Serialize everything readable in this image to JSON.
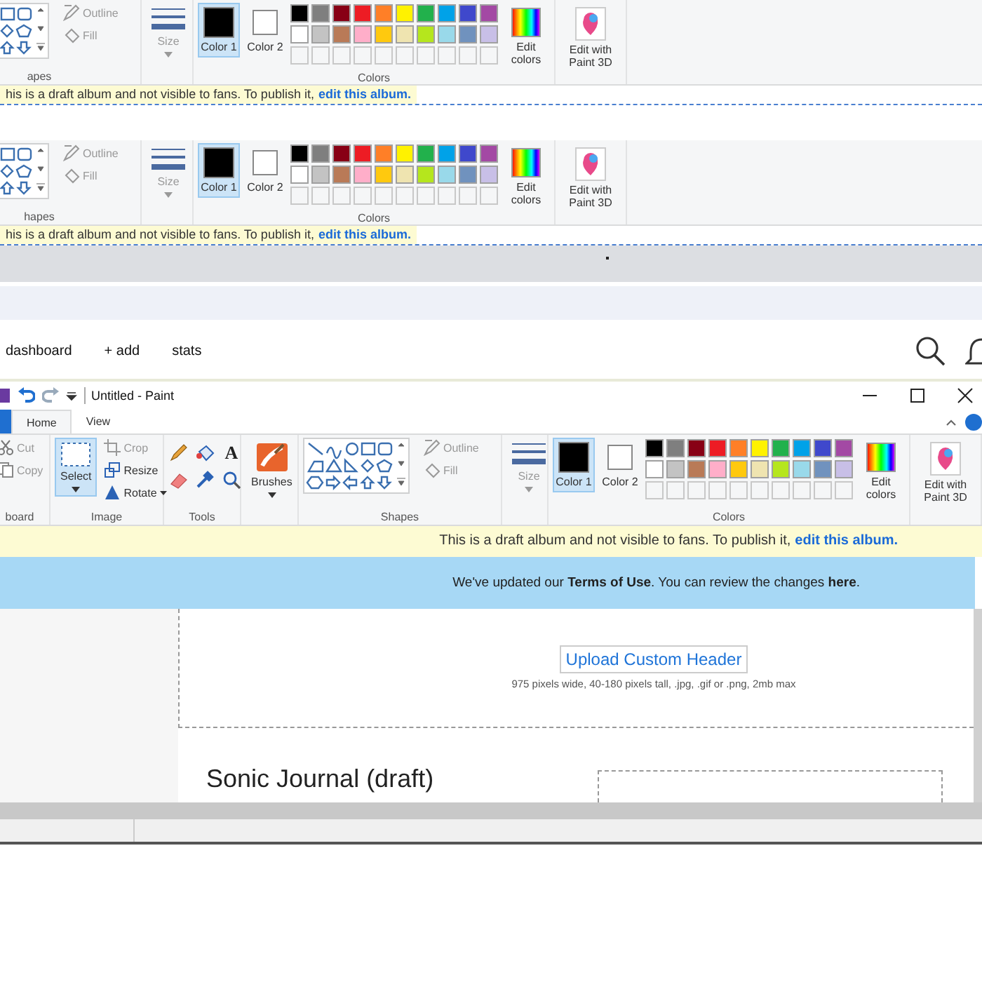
{
  "top_ribbons": [
    {
      "shapes_label": "apes",
      "outline": "Outline",
      "fill": "Fill",
      "size": "Size",
      "colors": [
        {
          "label": "Color 1",
          "selected": true
        },
        {
          "label": "Color 2",
          "selected": false
        }
      ],
      "palette": [
        {
          "color": "#000000"
        },
        {
          "color": "#7f7f7f"
        },
        {
          "color": "#880015"
        },
        {
          "color": "#ed1c24"
        },
        {
          "color": "#ff7f27"
        },
        {
          "color": "#fff200"
        },
        {
          "color": "#22b14c"
        },
        {
          "color": "#00a2e8"
        },
        {
          "color": "#3f48cc"
        },
        {
          "color": "#a349a4"
        },
        {
          "color": "#ffffff"
        },
        {
          "color": "#c3c3c3"
        },
        {
          "color": "#b97a57"
        },
        {
          "color": "#ffaec9"
        },
        {
          "color": "#ffc90e"
        },
        {
          "color": "#efe4b0"
        },
        {
          "color": "#b5e61d"
        },
        {
          "color": "#99d9ea"
        },
        {
          "color": "#7092be"
        },
        {
          "color": "#c8bfe7"
        }
      ],
      "edit_colors": "Edit colors",
      "paint_3d": "Edit with Paint 3D",
      "colors_label": "Colors",
      "draft_notice": "his is a draft album and not visible to fans. To publish it,",
      "draft_link": "edit this album."
    },
    {
      "shapes_label": "hapes",
      "outline": "Outline",
      "fill": "Fill",
      "size": "Size",
      "colors": [
        {
          "label": "Color 1",
          "selected": true
        },
        {
          "label": "Color 2",
          "selected": false
        }
      ],
      "palette": [
        {
          "color": "#000000"
        },
        {
          "color": "#7f7f7f"
        },
        {
          "color": "#880015"
        },
        {
          "color": "#ed1c24"
        },
        {
          "color": "#ff7f27"
        },
        {
          "color": "#fff200"
        },
        {
          "color": "#22b14c"
        },
        {
          "color": "#00a2e8"
        },
        {
          "color": "#3f48cc"
        },
        {
          "color": "#a349a4"
        },
        {
          "color": "#ffffff"
        },
        {
          "color": "#c3c3c3"
        },
        {
          "color": "#b97a57"
        },
        {
          "color": "#ffaec9"
        },
        {
          "color": "#ffc90e"
        },
        {
          "color": "#efe4b0"
        },
        {
          "color": "#b5e61d"
        },
        {
          "color": "#99d9ea"
        },
        {
          "color": "#7092be"
        },
        {
          "color": "#c8bfe7"
        }
      ],
      "edit_colors": "Edit colors",
      "paint_3d": "Edit with Paint 3D",
      "colors_label": "Colors",
      "draft_notice": "his is a draft album and not visible to fans. To publish it,",
      "draft_link": "edit this album."
    }
  ],
  "nav": {
    "items": [
      "dashboard",
      "+ add",
      "stats"
    ]
  },
  "paint_window": {
    "title": "Untitled - Paint",
    "tabs": [
      {
        "label": "Home",
        "selected": true
      },
      {
        "label": "View",
        "selected": false
      }
    ],
    "ribbon": {
      "clipboard": {
        "cut": "Cut",
        "copy": "Copy",
        "label": "board"
      },
      "image": {
        "select": "Select",
        "crop": "Crop",
        "resize": "Resize",
        "rotate": "Rotate",
        "label": "Image"
      },
      "tools": {
        "text_glyph": "A",
        "label": "Tools"
      },
      "brushes": "Brushes",
      "shapes_label": "Shapes",
      "outline": "Outline",
      "fill": "Fill",
      "size": "Size",
      "colors": [
        {
          "label": "Color 1",
          "selected": true
        },
        {
          "label": "Color 2",
          "selected": false
        }
      ],
      "palette": [
        {
          "color": "#000000"
        },
        {
          "color": "#7f7f7f"
        },
        {
          "color": "#880015"
        },
        {
          "color": "#ed1c24"
        },
        {
          "color": "#ff7f27"
        },
        {
          "color": "#fff200"
        },
        {
          "color": "#22b14c"
        },
        {
          "color": "#00a2e8"
        },
        {
          "color": "#3f48cc"
        },
        {
          "color": "#a349a4"
        },
        {
          "color": "#ffffff"
        },
        {
          "color": "#c3c3c3"
        },
        {
          "color": "#b97a57"
        },
        {
          "color": "#ffaec9"
        },
        {
          "color": "#ffc90e"
        },
        {
          "color": "#efe4b0"
        },
        {
          "color": "#b5e61d"
        },
        {
          "color": "#99d9ea"
        },
        {
          "color": "#7092be"
        },
        {
          "color": "#c8bfe7"
        }
      ],
      "edit_colors": "Edit colors",
      "paint_3d": "Edit with Paint 3D",
      "colors_label": "Colors"
    }
  },
  "draft_notice": {
    "text": "This is a draft album and not visible to fans. To publish it,",
    "link": "edit this album."
  },
  "terms_notice": "We've updated our **Terms of Use**. You can review the changes **here**.",
  "header_upload": {
    "button": "Upload Custom Header",
    "caption": "975 pixels wide, 40-180 pixels tall, .jpg, .gif or .png, 2mb max"
  },
  "album_title": "Sonic Journal (draft)"
}
